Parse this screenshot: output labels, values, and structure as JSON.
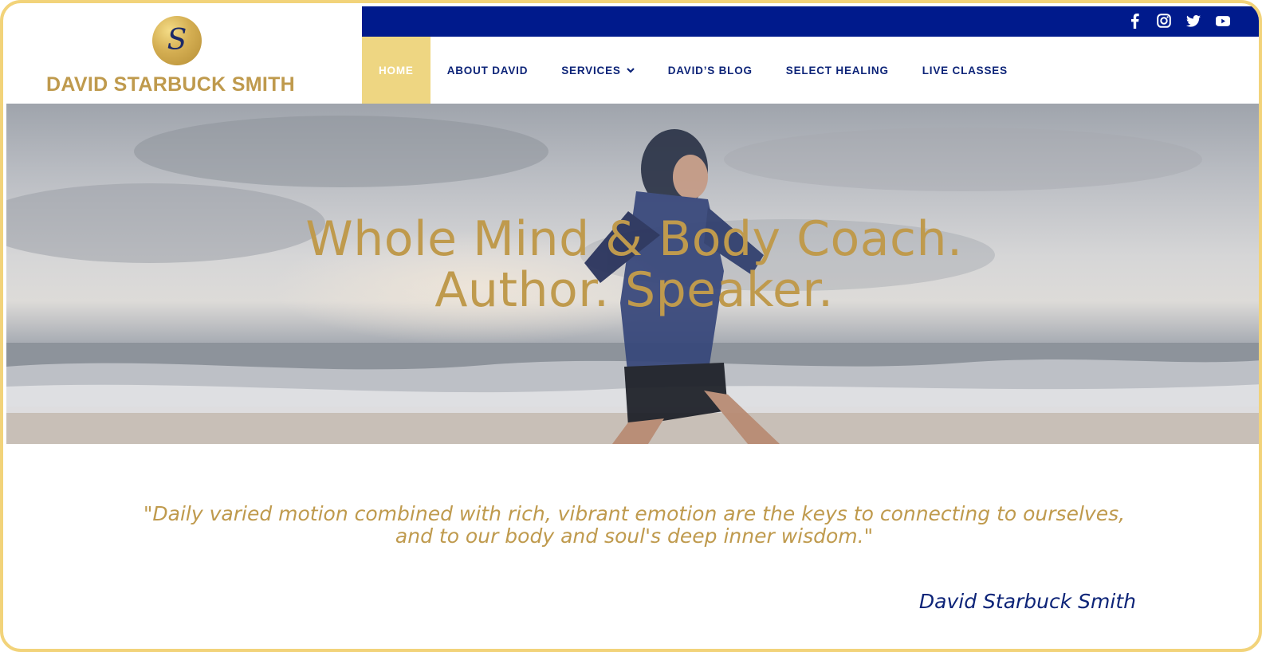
{
  "logo": {
    "monogram": "S",
    "name": "DAVID STARBUCK SMITH"
  },
  "social": [
    {
      "icon": "facebook-icon"
    },
    {
      "icon": "instagram-icon"
    },
    {
      "icon": "twitter-icon"
    },
    {
      "icon": "youtube-icon"
    }
  ],
  "nav": {
    "home": "HOME",
    "about": "ABOUT DAVID",
    "services": "SERVICES",
    "blog": "DAVID’S BLOG",
    "healing": "SELECT HEALING",
    "classes": "LIVE CLASSES"
  },
  "hero": {
    "line1": "Whole Mind & Body Coach.",
    "line2": "Author. Speaker."
  },
  "quote": {
    "line1": "\"Daily varied motion combined with rich, vibrant emotion are the keys to connecting to ourselves,",
    "line2": "and to our body and soul's deep inner wisdom.\"",
    "author": "David Starbuck Smith"
  },
  "colors": {
    "gold": "#bf9a4d",
    "navy": "#001a8c",
    "nav_active": "#eed682",
    "frame": "#f2d37a"
  }
}
